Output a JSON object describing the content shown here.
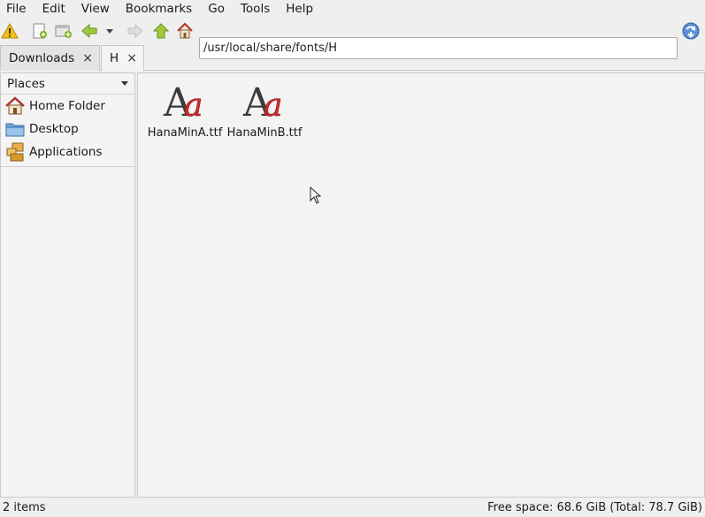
{
  "menubar": {
    "items": [
      "File",
      "Edit",
      "View",
      "Bookmarks",
      "Go",
      "Tools",
      "Help"
    ]
  },
  "toolbar": {
    "buttons": [
      {
        "icon": "warning-icon"
      },
      {
        "icon": "new-tab-icon"
      },
      {
        "icon": "new-window-icon"
      },
      {
        "icon": "back-icon"
      },
      {
        "icon": "history-dropdown-icon"
      },
      {
        "icon": "forward-icon"
      },
      {
        "icon": "up-icon"
      },
      {
        "icon": "home-icon"
      },
      {
        "icon": "go-icon"
      }
    ],
    "address": "/usr/local/share/fonts/H"
  },
  "tabs": [
    {
      "label": "Downloads",
      "close": "×"
    },
    {
      "label": "H",
      "close": "×"
    }
  ],
  "sidebar": {
    "header": "Places",
    "items": [
      {
        "label": "Home Folder",
        "icon": "home-folder-icon"
      },
      {
        "label": "Desktop",
        "icon": "desktop-folder-icon"
      },
      {
        "label": "Applications",
        "icon": "applications-icon"
      }
    ]
  },
  "files": [
    {
      "name": "HanaMinA.ttf",
      "icon": "font-file-icon"
    },
    {
      "name": "HanaMinB.ttf",
      "icon": "font-file-icon"
    }
  ],
  "status": {
    "count": "2 items",
    "free_space": "Free space: 68.6 GiB (Total: 78.7 GiB)"
  },
  "colors": {
    "accent_green": "#7cb518",
    "home_red": "#b8372a",
    "font_icon_red": "#d42a2a"
  }
}
